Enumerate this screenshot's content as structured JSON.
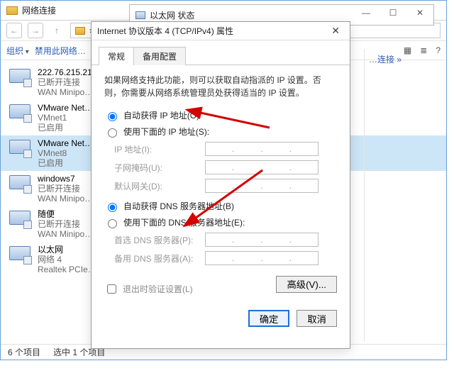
{
  "parent": {
    "title": "网络连接",
    "nav": {
      "back": "←",
      "fwd": "→",
      "up": "↑",
      "chevron": "›"
    },
    "cmdbar": {
      "organize": "组织",
      "disable": "禁用此网络…",
      "view_icon": "▦",
      "list_icon": "≣",
      "help_icon": "?"
    },
    "items": [
      {
        "l1": "222.76.215.21…",
        "l2": "已断开连接",
        "l3": "WAN Minipo…"
      },
      {
        "l1": "VMware Net…",
        "l2": "VMnet1",
        "l3": "已启用"
      },
      {
        "l1": "VMware Net…",
        "l2": "VMnet8",
        "l3": "已启用"
      },
      {
        "l1": "windows7",
        "l2": "已断开连接",
        "l3": "WAN Minipo…"
      },
      {
        "l1": "随便",
        "l2": "已断开连接",
        "l3": "WAN Minipo…"
      },
      {
        "l1": "以太网",
        "l2": "网络 4",
        "l3": "Realtek PCIe…"
      }
    ],
    "status": {
      "count": "6 个项目",
      "selected": "选中 1 个项目"
    },
    "right_hint": "…连接 »"
  },
  "backwin": {
    "title": "以太网 状态",
    "min": "—",
    "max": "☐",
    "close": "✕"
  },
  "dlg": {
    "title": "Internet 协议版本 4 (TCP/IPv4) 属性",
    "close": "✕",
    "tabs": {
      "general": "常规",
      "alt": "备用配置"
    },
    "desc": "如果网络支持此功能，则可以获取自动指派的 IP 设置。否则，你需要从网络系统管理员处获得适当的 IP 设置。",
    "ip": {
      "auto": "自动获得 IP 地址(O)",
      "manual": "使用下面的 IP 地址(S):",
      "addr": "IP 地址(I):",
      "mask": "子网掩码(U):",
      "gateway": "默认网关(D):"
    },
    "dns": {
      "auto": "自动获得 DNS 服务器地址(B)",
      "manual": "使用下面的 DNS 服务器地址(E):",
      "pref": "首选 DNS 服务器(P):",
      "alt": "备用 DNS 服务器(A):"
    },
    "validate": "退出时验证设置(L)",
    "advanced": "高级(V)...",
    "ok": "确定",
    "cancel": "取消"
  }
}
